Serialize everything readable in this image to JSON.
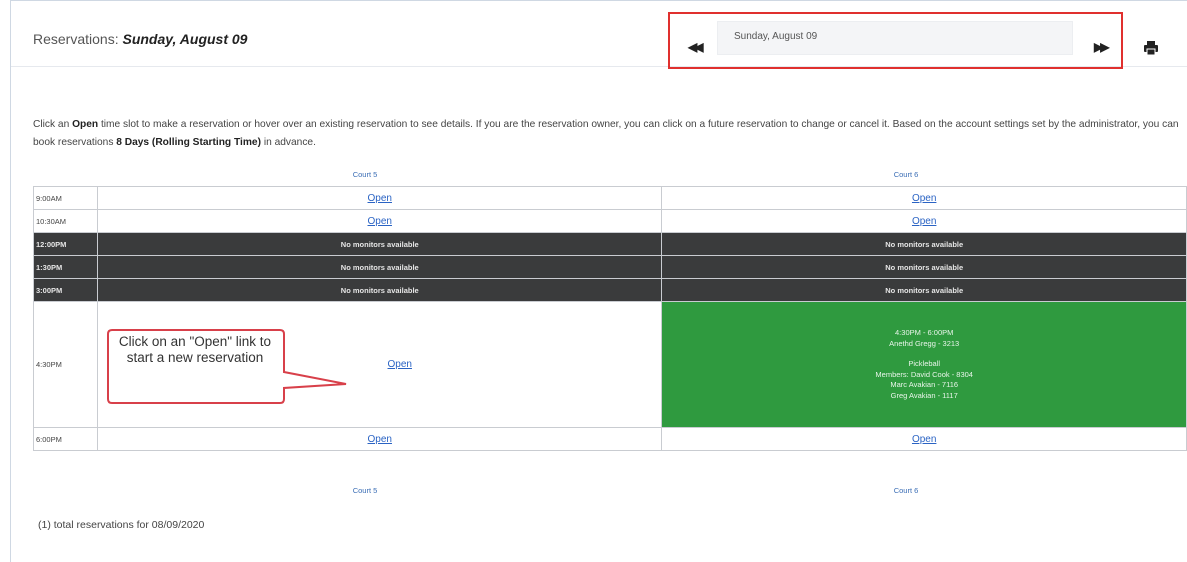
{
  "header": {
    "title_prefix": "Reservations: ",
    "title_date": "Sunday, August 09"
  },
  "date_picker": {
    "value": "Sunday, August 09",
    "prev_symbol": "◀◀",
    "next_symbol": "▶▶"
  },
  "intro": {
    "part1": "Click an ",
    "open_word": "Open",
    "part2": " time slot to make a reservation or hover over an existing reservation to see details. If you are the reservation owner, you can click on a future reservation to change or cancel it. Based on the account settings set by the administrator, you can book reservations ",
    "bold_days": "8 Days (Rolling Starting Time)",
    "part3": " in advance."
  },
  "courts": {
    "court5": "Court 5",
    "court6": "Court 6"
  },
  "rows": [
    {
      "time": "9:00AM",
      "c5": "Open",
      "c6": "Open"
    },
    {
      "time": "10:30AM",
      "c5": "Open",
      "c6": "Open"
    },
    {
      "time": "12:00PM",
      "c5": "No monitors available",
      "c6": "No monitors available"
    },
    {
      "time": "1:30PM",
      "c5": "No monitors available",
      "c6": "No monitors available"
    },
    {
      "time": "3:00PM",
      "c5": "No monitors available",
      "c6": "No monitors available"
    },
    {
      "time": "4:30PM",
      "c5": "Open"
    },
    {
      "time": "6:00PM",
      "c5": "Open",
      "c6": "Open"
    }
  ],
  "reservation": {
    "time": "4:30PM - 6:00PM",
    "owner": "Anethd Gregg - 3213",
    "type": "Pickleball",
    "members_line": "Members: David Cook - 8304",
    "member2": "Marc Avakian - 7116",
    "member3": "Greg Avakian - 1117"
  },
  "callout": {
    "text": "Click on an \"Open\" link to start a new reservation"
  },
  "footer": {
    "total": "(1) total reservations for 08/09/2020"
  },
  "colors": {
    "highlight_border": "#e0302e",
    "reserved": "#2f9a3f",
    "unavailable": "#3a3b3c",
    "link": "#2a63c4"
  },
  "icons": {
    "print": "printer-icon",
    "prev": "double-chevron-left-icon",
    "next": "double-chevron-right-icon"
  }
}
